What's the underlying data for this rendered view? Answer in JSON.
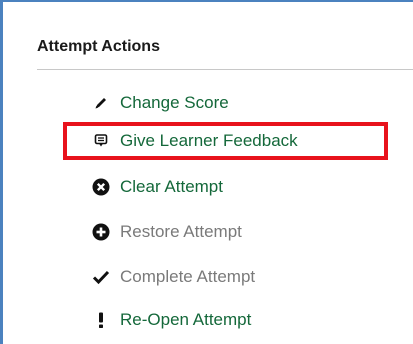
{
  "section": {
    "title": "Attempt Actions"
  },
  "actions": [
    {
      "label": "Change Score",
      "icon": "pencil-icon",
      "state": "enabled"
    },
    {
      "label": "Give Learner Feedback",
      "icon": "feedback-icon",
      "state": "enabled",
      "highlighted": true
    },
    {
      "label": "Clear Attempt",
      "icon": "clear-circle-icon",
      "state": "enabled"
    },
    {
      "label": "Restore Attempt",
      "icon": "restore-circle-icon",
      "state": "disabled"
    },
    {
      "label": "Complete Attempt",
      "icon": "checkmark-icon",
      "state": "disabled"
    },
    {
      "label": "Re-Open Attempt",
      "icon": "exclamation-icon",
      "state": "enabled"
    }
  ],
  "colors": {
    "panel_border": "#4b82bf",
    "link_green": "#14683a",
    "disabled_gray": "#7a7a7a",
    "highlight_red": "#e8121c"
  }
}
